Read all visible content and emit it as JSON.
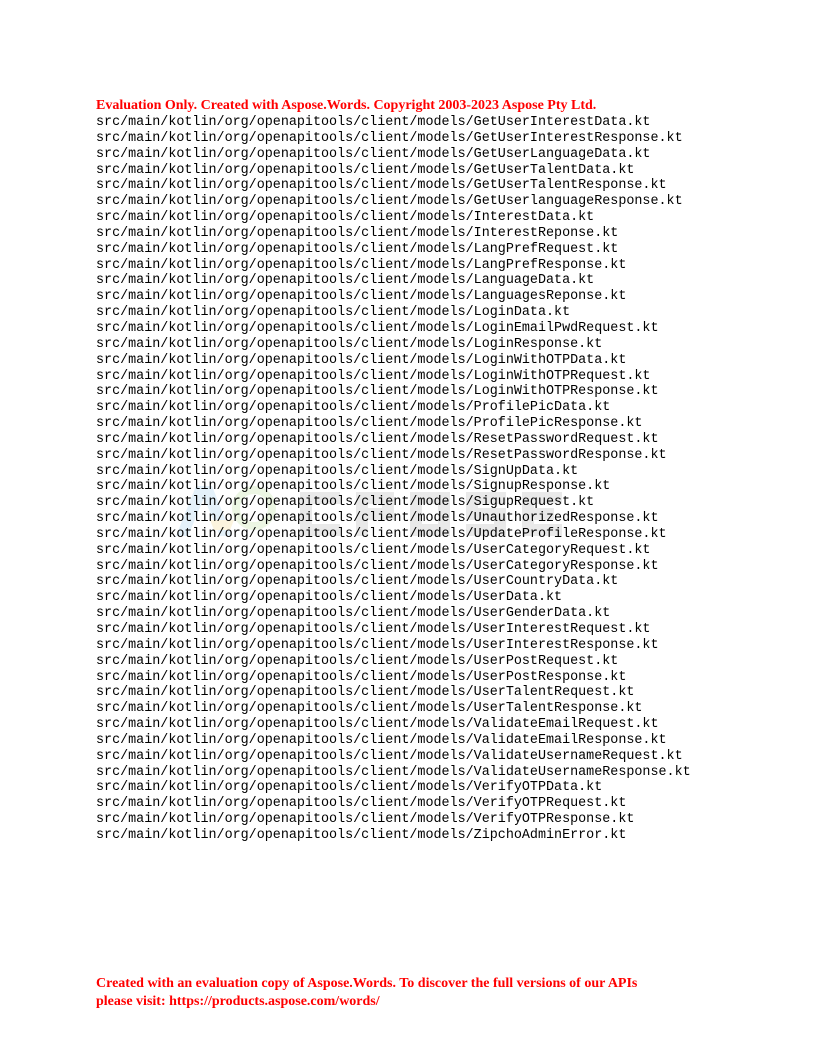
{
  "header": {
    "evaluation_notice": "Evaluation  Only. Created with  Aspose.Words. Copyright  2003-2023 Aspose Pty Ltd."
  },
  "files": [
    "src/main/kotlin/org/openapitools/client/models/GetUserInterestData.kt",
    "src/main/kotlin/org/openapitools/client/models/GetUserInterestResponse.kt",
    "src/main/kotlin/org/openapitools/client/models/GetUserLanguageData.kt",
    "src/main/kotlin/org/openapitools/client/models/GetUserTalentData.kt",
    "src/main/kotlin/org/openapitools/client/models/GetUserTalentResponse.kt",
    "src/main/kotlin/org/openapitools/client/models/GetUserlanguageResponse.kt",
    "src/main/kotlin/org/openapitools/client/models/InterestData.kt",
    "src/main/kotlin/org/openapitools/client/models/InterestReponse.kt",
    "src/main/kotlin/org/openapitools/client/models/LangPrefRequest.kt",
    "src/main/kotlin/org/openapitools/client/models/LangPrefResponse.kt",
    "src/main/kotlin/org/openapitools/client/models/LanguageData.kt",
    "src/main/kotlin/org/openapitools/client/models/LanguagesReponse.kt",
    "src/main/kotlin/org/openapitools/client/models/LoginData.kt",
    "src/main/kotlin/org/openapitools/client/models/LoginEmailPwdRequest.kt",
    "src/main/kotlin/org/openapitools/client/models/LoginResponse.kt",
    "src/main/kotlin/org/openapitools/client/models/LoginWithOTPData.kt",
    "src/main/kotlin/org/openapitools/client/models/LoginWithOTPRequest.kt",
    "src/main/kotlin/org/openapitools/client/models/LoginWithOTPResponse.kt",
    "src/main/kotlin/org/openapitools/client/models/ProfilePicData.kt",
    "src/main/kotlin/org/openapitools/client/models/ProfilePicResponse.kt",
    "src/main/kotlin/org/openapitools/client/models/ResetPasswordRequest.kt",
    "src/main/kotlin/org/openapitools/client/models/ResetPasswordResponse.kt",
    "src/main/kotlin/org/openapitools/client/models/SignUpData.kt",
    "src/main/kotlin/org/openapitools/client/models/SignupResponse.kt",
    "src/main/kotlin/org/openapitools/client/models/SigupRequest.kt",
    "src/main/kotlin/org/openapitools/client/models/UnauthorizedResponse.kt",
    "src/main/kotlin/org/openapitools/client/models/UpdateProfileResponse.kt",
    "src/main/kotlin/org/openapitools/client/models/UserCategoryRequest.kt",
    "src/main/kotlin/org/openapitools/client/models/UserCategoryResponse.kt",
    "src/main/kotlin/org/openapitools/client/models/UserCountryData.kt",
    "src/main/kotlin/org/openapitools/client/models/UserData.kt",
    "src/main/kotlin/org/openapitools/client/models/UserGenderData.kt",
    "src/main/kotlin/org/openapitools/client/models/UserInterestRequest.kt",
    "src/main/kotlin/org/openapitools/client/models/UserInterestResponse.kt",
    "src/main/kotlin/org/openapitools/client/models/UserPostRequest.kt",
    "src/main/kotlin/org/openapitools/client/models/UserPostResponse.kt",
    "src/main/kotlin/org/openapitools/client/models/UserTalentRequest.kt",
    "src/main/kotlin/org/openapitools/client/models/UserTalentResponse.kt",
    "src/main/kotlin/org/openapitools/client/models/ValidateEmailRequest.kt",
    "src/main/kotlin/org/openapitools/client/models/ValidateEmailResponse.kt",
    "src/main/kotlin/org/openapitools/client/models/ValidateUsernameRequest.kt",
    "src/main/kotlin/org/openapitools/client/models/ValidateUsernameResponse.kt",
    "src/main/kotlin/org/openapitools/client/models/VerifyOTPData.kt",
    "src/main/kotlin/org/openapitools/client/models/VerifyOTPRequest.kt",
    "src/main/kotlin/org/openapitools/client/models/VerifyOTPResponse.kt",
    "src/main/kotlin/org/openapitools/client/models/ZipchoAdminError.kt"
  ],
  "footer": {
    "line1": "Created with  an evaluation copy of Aspose.Words. To discover the full versions of our APIs",
    "line2": "please visit: https://products.aspose.com/words/"
  },
  "colors": {
    "notice": "#ff0000",
    "text": "#000000",
    "background": "#ffffff"
  },
  "watermark_icon": "aspose-logo-watermark"
}
